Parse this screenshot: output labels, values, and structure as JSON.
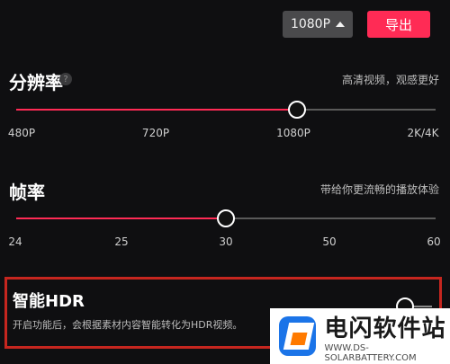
{
  "toolbar": {
    "resolution_value": "1080P",
    "export_label": "导出"
  },
  "resolution": {
    "title": "分辨率",
    "hint": "高清视频，观感更好",
    "ticks": [
      "480P",
      "720P",
      "1080P",
      "2K/4K"
    ],
    "selected_label": "1080P",
    "selected_fraction": 0.67
  },
  "framerate": {
    "title": "帧率",
    "hint": "带给你更流畅的播放体验",
    "ticks": [
      "24",
      "25",
      "30",
      "50",
      "60"
    ],
    "selected_label": "30",
    "selected_fraction": 0.5
  },
  "hdr": {
    "title": "智能HDR",
    "desc": "开启功能后，会根据素材内容智能转化为HDR视频。",
    "enabled": false
  },
  "watermark": {
    "name": "电闪软件站",
    "url": "WWW.DS-SOLARBATTERY.COM"
  },
  "colors": {
    "accent": "#ff2b55",
    "highlight_border": "#c6261f",
    "background": "#0f0f11"
  }
}
